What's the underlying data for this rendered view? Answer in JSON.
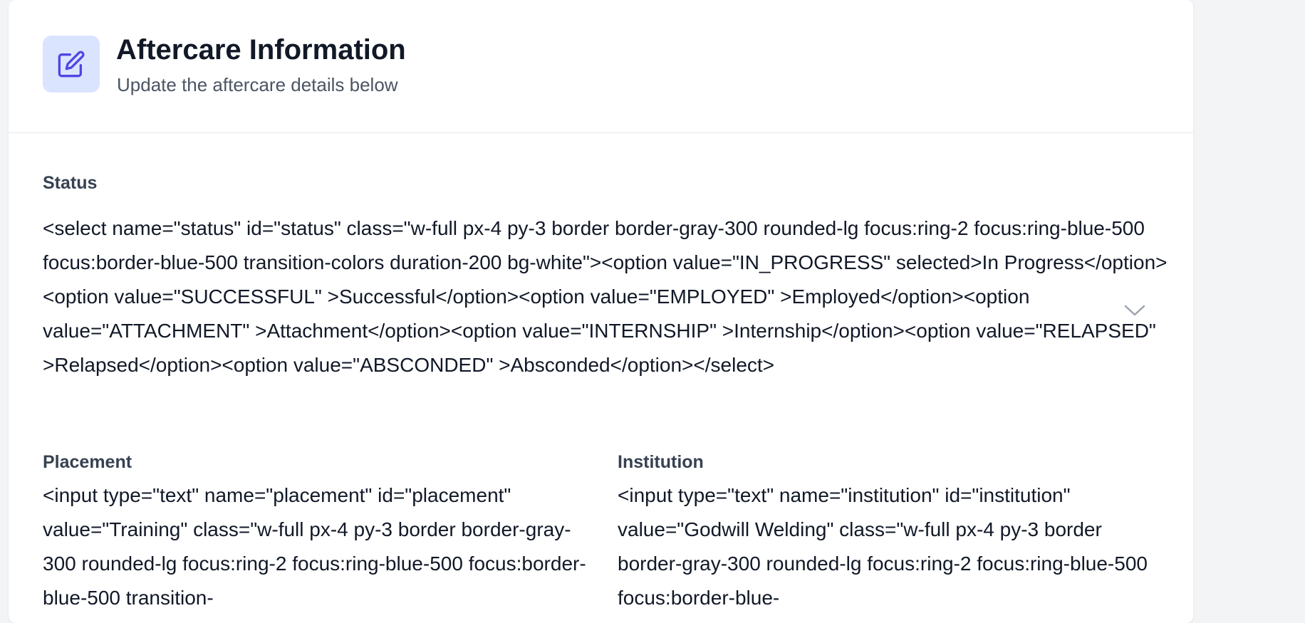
{
  "header": {
    "icon": "edit-icon",
    "title": "Aftercare Information",
    "subtitle": "Update the aftercare details below"
  },
  "colors": {
    "accent": "#4f46e5",
    "icon_tile_bg": "#dbe4ff",
    "divider": "#e5e7eb"
  },
  "status": {
    "label": "Status",
    "raw_markup": "<select name=\"status\" id=\"status\" class=\"w-full px-4 py-3 border border-gray-300 rounded-lg focus:ring-2 focus:ring-blue-500 focus:border-blue-500 transition-colors duration-200 bg-white\"><option value=\"IN_PROGRESS\" selected>In Progress</option><option value=\"SUCCESSFUL\" >Successful</option><option value=\"EMPLOYED\" >Employed</option><option value=\"ATTACHMENT\" >Attachment</option><option value=\"INTERNSHIP\" >Internship</option><option value=\"RELAPSED\" >Relapsed</option><option value=\"ABSCONDED\" >Absconded</option></select>",
    "chevron_icon": "chevron-down-icon"
  },
  "placement": {
    "label": "Placement",
    "raw_markup": "<input type=\"text\" name=\"placement\" id=\"placement\" value=\"Training\" class=\"w-full px-4 py-3 border border-gray-300 rounded-lg focus:ring-2 focus:ring-blue-500 focus:border-blue-500 transition-"
  },
  "institution": {
    "label": "Institution",
    "raw_markup": "<input type=\"text\" name=\"institution\" id=\"institution\" value=\"Godwill Welding\" class=\"w-full px-4 py-3 border border-gray-300 rounded-lg focus:ring-2 focus:ring-blue-500 focus:border-blue-"
  }
}
